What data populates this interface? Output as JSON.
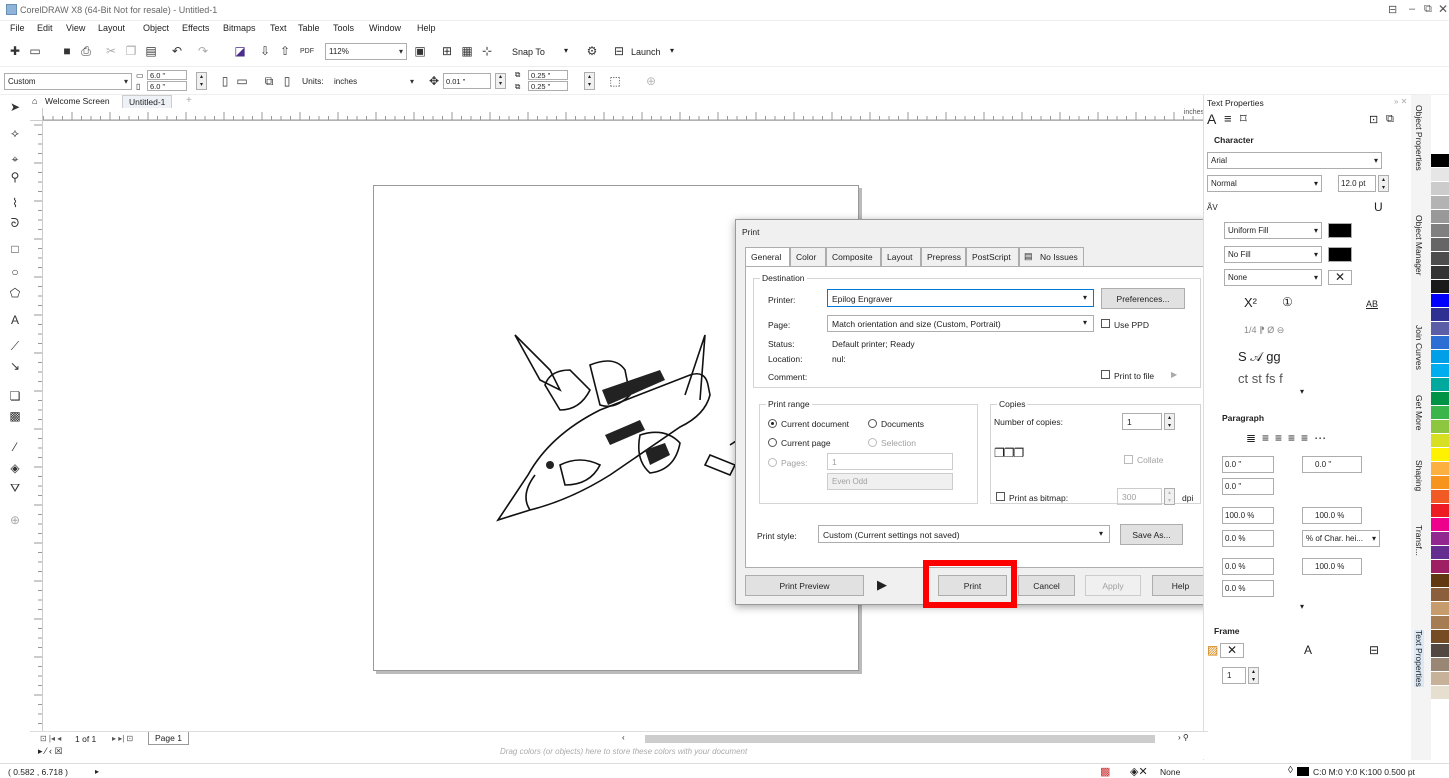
{
  "window": {
    "title": "CorelDRAW X8 (64-Bit Not for resale) - Untitled-1"
  },
  "menu": [
    "File",
    "Edit",
    "View",
    "Layout",
    "Object",
    "Effects",
    "Bitmaps",
    "Text",
    "Table",
    "Tools",
    "Window",
    "Help"
  ],
  "toolbar": {
    "zoom": "112%",
    "snap_to": "Snap To",
    "launch": "Launch"
  },
  "property_bar": {
    "page_preset": "Custom",
    "width": "6.0 \"",
    "height": "6.0 \"",
    "units_label": "Units:",
    "units_value": "inches",
    "nudge": "0.01 \"",
    "dup_x": "0.25 \"",
    "dup_y": "0.25 \""
  },
  "doc_tabs": {
    "welcome": "Welcome Screen",
    "untitled": "Untitled-1",
    "page_nav": "1 of 1",
    "page_tab": "Page 1"
  },
  "ruler_units": "inches",
  "color_well_hint": "Drag colors (or objects) here to store these colors with your document",
  "status": {
    "coords": "( 0.582 , 6.718 )",
    "fill": "None",
    "outline": "C:0 M:0 Y:0 K:100  0.500 pt"
  },
  "print_dialog": {
    "title": "Print",
    "tabs": [
      "General",
      "Color",
      "Composite",
      "Layout",
      "Prepress",
      "PostScript",
      "No Issues"
    ],
    "destination_label": "Destination",
    "printer_label": "Printer:",
    "printer_value": "Epilog Engraver",
    "preferences_btn": "Preferences...",
    "page_label": "Page:",
    "page_value": "Match orientation and size (Custom, Portrait)",
    "use_ppd": "Use PPD",
    "status_label": "Status:",
    "status_value": "Default printer; Ready",
    "location_label": "Location:",
    "location_value": "nul:",
    "comment_label": "Comment:",
    "print_to_file": "Print to file",
    "print_range_label": "Print range",
    "current_document": "Current document",
    "documents": "Documents",
    "current_page": "Current page",
    "selection": "Selection",
    "pages": "Pages:",
    "pages_value": "1",
    "even_odd": "Even Odd",
    "copies_label": "Copies",
    "num_copies_label": "Number of copies:",
    "num_copies_value": "1",
    "collate": "Collate",
    "print_as_bitmap": "Print as bitmap:",
    "dpi_value": "300",
    "dpi": "dpi",
    "print_style_label": "Print style:",
    "print_style_value": "Custom (Current settings not saved)",
    "save_as_btn": "Save As...",
    "print_preview_btn": "Print Preview",
    "print_btn": "Print",
    "cancel_btn": "Cancel",
    "apply_btn": "Apply",
    "help_btn": "Help"
  },
  "text_properties": {
    "title": "Text Properties",
    "character": "Character",
    "font": "Arial",
    "style": "Normal",
    "size": "12.0 pt",
    "fill1": "Uniform Fill",
    "fill2": "No Fill",
    "fill3": "None",
    "paragraph": "Paragraph",
    "indent1": "0.0 \"",
    "indent2": "0.0 \"",
    "indent3": "0.0 \"",
    "spacing1": "100.0 %",
    "spacing2": "100.0 %",
    "spacing3": "0.0 %",
    "spacing4": "% of Char. hei...",
    "spacing5": "0.0 %",
    "spacing6": "100.0 %",
    "spacing7": "0.0 %",
    "frame": "Frame",
    "frame_cols": "1"
  },
  "docker_tabs": [
    "Object Properties",
    "Object Manager",
    "Join Curves",
    "Get More",
    "Shaping",
    "Transf...",
    "Text Properties"
  ],
  "palette": [
    "#ffffff",
    "#000000",
    "#e6e6e6",
    "#cccccc",
    "#b3b3b3",
    "#999999",
    "#808080",
    "#666666",
    "#4d4d4d",
    "#333333",
    "#1a1a1a",
    "#0000ff",
    "#2e3192",
    "#5b5ea6",
    "#2b6fd4",
    "#00a0e9",
    "#00aeef",
    "#00a99d",
    "#009245",
    "#39b54a",
    "#8dc63f",
    "#d7df23",
    "#fff200",
    "#fbb040",
    "#f7941d",
    "#f15a24",
    "#ed1c24",
    "#ec008c",
    "#92278f",
    "#662d91",
    "#9e1f63",
    "#603913",
    "#8b5e3c",
    "#c69c6d",
    "#a67c52",
    "#754c24",
    "#534741",
    "#998675",
    "#c7b299",
    "#e6dfd0"
  ],
  "accent_red": "#ff0000",
  "dialog_link_blue": "#0078d7"
}
